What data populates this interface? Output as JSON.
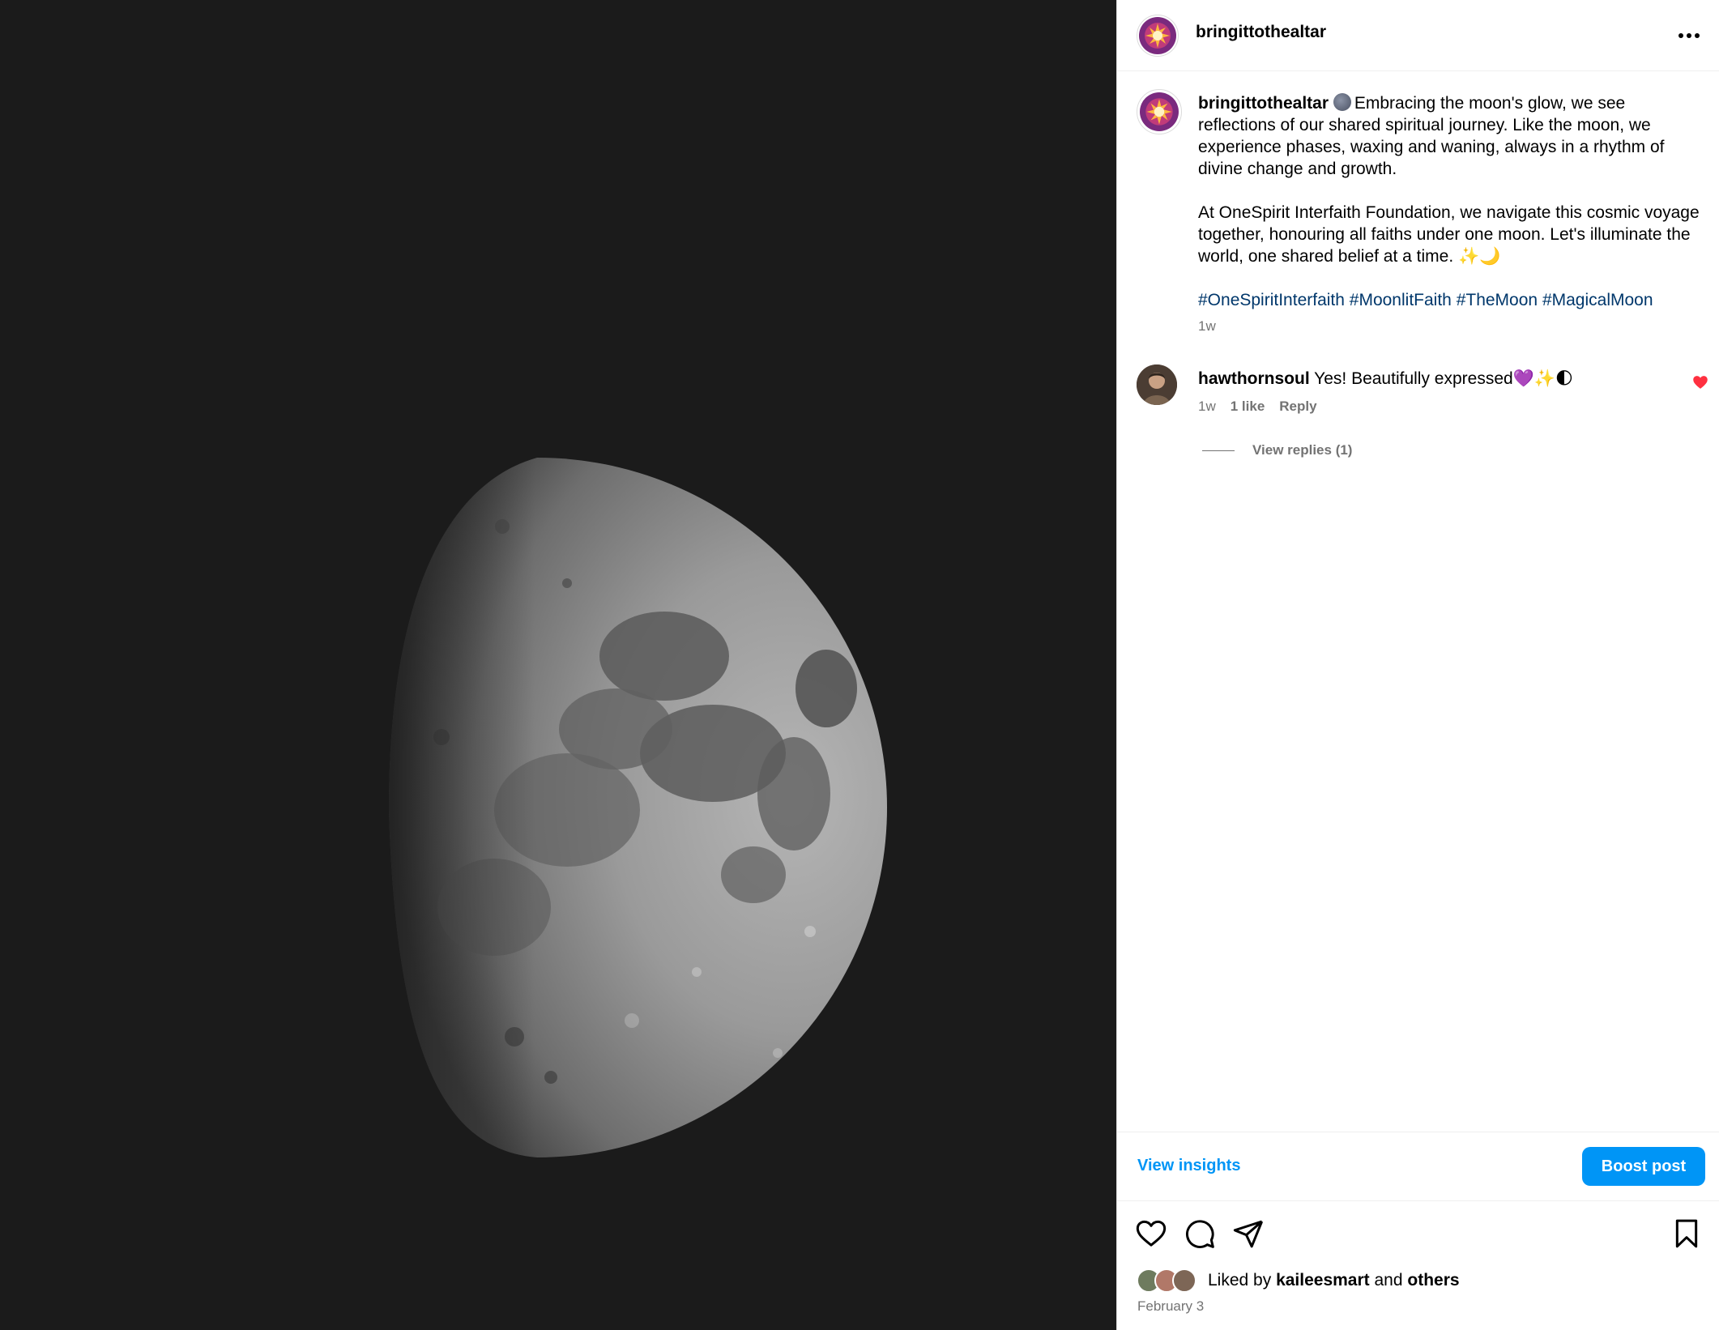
{
  "post": {
    "author": "bringittothealtar",
    "caption_paragraph_1": "Embracing the moon's glow, we see reflections of our shared spiritual journey. Like the moon, we experience phases, waxing and waning, always in a rhythm of divine change and growth.",
    "caption_paragraph_2": "At OneSpirit Interfaith Foundation, we navigate this cosmic voyage together, honouring all faiths under one moon. Let's illuminate the world, one shared belief at a time. ✨🌙",
    "hashtags": [
      "#OneSpiritInterfaith",
      "#MoonlitFaith",
      "#TheMoon",
      "#MagicalMoon"
    ],
    "time_ago": "1w",
    "more_icon": "more-horizontal-icon"
  },
  "comment": {
    "author": "hawthornsoul",
    "text": "Yes! Beautifully expressed💜✨🌓",
    "time_ago": "1w",
    "likes": "1 like",
    "reply_label": "Reply",
    "view_replies": "View replies (1)",
    "liked": true
  },
  "insights": {
    "view_insights_label": "View insights",
    "boost_label": "Boost post"
  },
  "footer": {
    "liked_by_prefix": "Liked by",
    "liked_by_user": "kaileesmart",
    "liked_by_and": "and",
    "liked_by_others": "others",
    "date": "February 3"
  },
  "colors": {
    "accent": "#0095f6",
    "hashtag": "#00376b",
    "secondary_text": "#737373",
    "like_red": "#ff3040",
    "media_bg": "#1b1b1b"
  }
}
